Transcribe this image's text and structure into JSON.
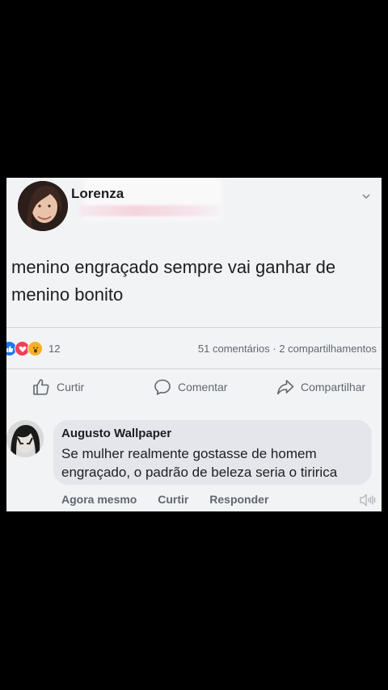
{
  "post": {
    "author": "Lorenza",
    "text": "menino engraçado sempre vai ganhar de menino bonito",
    "reaction_count": "12",
    "stats": "51 comentários · 2 compartilhamentos"
  },
  "actions": {
    "like": "Curtir",
    "comment": "Comentar",
    "share": "Compartilhar"
  },
  "comment": {
    "author": "Augusto Wallpaper",
    "text": "Se mulher realmente gostasse de homem engraçado, o padrão de beleza seria o tiririca",
    "time": "Agora mesmo",
    "like": "Curtir",
    "reply": "Responder"
  },
  "colors": {
    "background": "#000000",
    "card": "#f2f3f5",
    "bubble": "#e4e6eb",
    "text": "#1c1e21",
    "muted": "#606770",
    "like_blue": "#1877f2",
    "love_red": "#f33e58",
    "haha_yellow": "#f7b125"
  },
  "icons": {
    "like": "thumbs-up-icon",
    "comment": "speech-bubble-icon",
    "share": "share-arrow-icon",
    "menu": "chevron-down-icon",
    "audio": "speaker-icon"
  }
}
